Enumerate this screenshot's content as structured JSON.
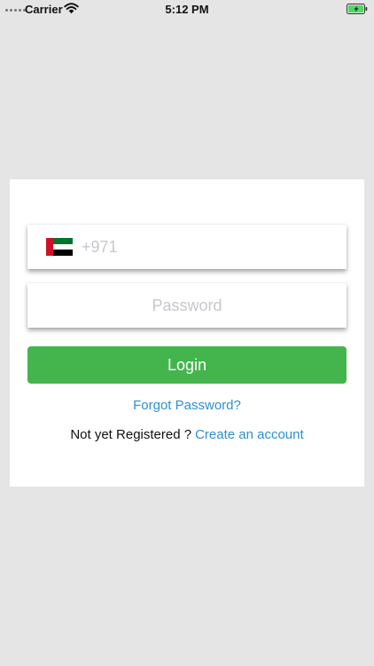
{
  "status_bar": {
    "carrier": "Carrier",
    "time": "5:12 PM",
    "icons": [
      "signal-dots-icon",
      "wifi-icon",
      "battery-charging-icon"
    ]
  },
  "login_form": {
    "country_flag": "UAE",
    "phone_placeholder": "+971",
    "password_placeholder": "Password",
    "login_label": "Login",
    "forgot_password": "Forgot Password?",
    "not_registered": "Not yet Registered ?",
    "create_account": "Create an account"
  },
  "colors": {
    "background": "#e5e5e5",
    "card": "#ffffff",
    "accent_green": "#44b54c",
    "link_blue": "#2e8fd1",
    "flag_red": "#ce1126",
    "flag_green": "#00732f",
    "flag_white": "#ffffff",
    "flag_black": "#000000",
    "battery_green": "#4cd964"
  }
}
